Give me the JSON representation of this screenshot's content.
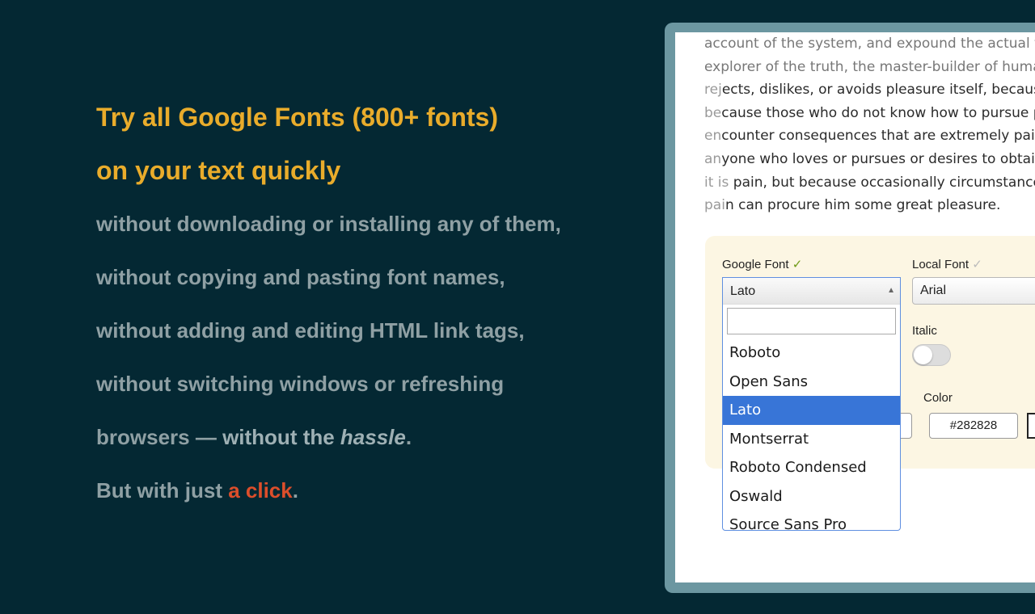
{
  "hero": {
    "headline_line1": "Try all Google Fonts (800+ fonts)",
    "headline_line2": "on your text quickly",
    "lines": [
      "without downloading or installing any of them,",
      "without copying and pasting font names,",
      "without adding and editing HTML link tags,",
      "without switching windows or refreshing"
    ],
    "line5_prefix": "browsers — ",
    "line5_strong": "without the ",
    "line5_em": "hassle",
    "line5_suffix": ".",
    "line6_prefix": "But with just ",
    "line6_accent": "a click",
    "line6_suffix": "."
  },
  "preview": {
    "sample_lines": [
      {
        "faded": "",
        "text": "account of the system, and expound the actual tea",
        "top": true
      },
      {
        "faded": "",
        "text": "explorer of the truth, the master-builder of human",
        "top": true
      },
      {
        "faded": "rej",
        "text": "ects, dislikes, or avoids pleasure itself, because i"
      },
      {
        "faded": "be",
        "text": "cause those who do not know how to pursue ple"
      },
      {
        "faded": "en",
        "text": "counter consequences that are extremely painf"
      },
      {
        "faded": "an",
        "text": "yone who loves or pursues or desires to obtain p"
      },
      {
        "faded": "it is",
        "text": " pain, but because occasionally circumstances o"
      },
      {
        "faded": "pai",
        "text": "n can procure him some great pleasure."
      }
    ],
    "panel": {
      "google_font_label": "Google Font",
      "google_font_check": "✓",
      "local_font_label": "Local Font",
      "local_font_check": "✓",
      "local_font_value": "Arial",
      "italic_label": "Italic",
      "color_label": "Color",
      "color_value": "#282828"
    },
    "dropdown": {
      "selected_value": "Lato",
      "search_value": "",
      "options": [
        "Roboto",
        "Open Sans",
        "Lato",
        "Montserrat",
        "Roboto Condensed",
        "Oswald",
        "Source Sans Pro"
      ],
      "selected_index": 2
    }
  },
  "colors": {
    "background": "#042833",
    "headline": "#e9ac2b",
    "accent": "#dc4e2b",
    "window_frame": "#6c97a1",
    "selected_option": "#3875d7"
  }
}
